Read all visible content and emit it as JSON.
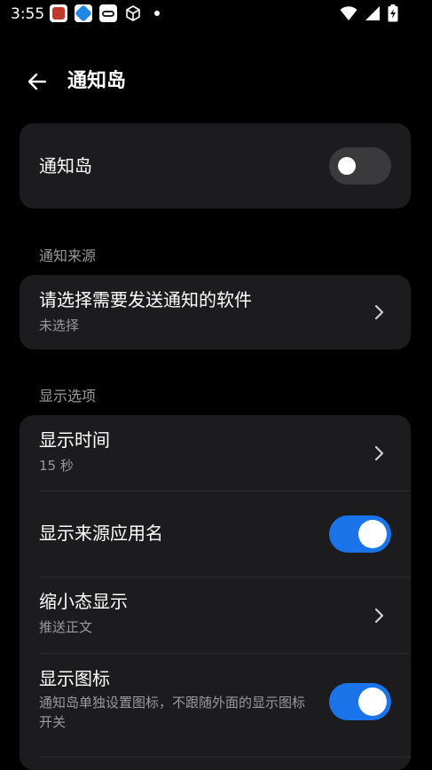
{
  "status_bar": {
    "time": "3:55",
    "icons_left": [
      "app-red-icon",
      "app-blue-icon",
      "link-icon",
      "cube-icon",
      "dot-icon"
    ],
    "icons_right": [
      "wifi-icon",
      "signal-icon",
      "battery-charging-icon"
    ]
  },
  "app_bar": {
    "title": "通知岛"
  },
  "main_toggle": {
    "label": "通知岛",
    "enabled": false
  },
  "sections": {
    "source_header": "通知来源",
    "display_header": "显示选项"
  },
  "source": {
    "title": "请选择需要发送通知的软件",
    "subtitle": "未选择"
  },
  "display_options": {
    "show_time": {
      "title": "显示时间",
      "subtitle": "15 秒"
    },
    "show_app_name": {
      "title": "显示来源应用名",
      "enabled": true
    },
    "mini_display": {
      "title": "缩小态显示",
      "subtitle": "推送正文"
    },
    "show_icon": {
      "title": "显示图标",
      "subtitle": "通知岛单独设置图标，不跟随外面的显示图标开关",
      "enabled": true
    }
  },
  "colors": {
    "background": "#000000",
    "card": "#1c1c1e",
    "accent": "#1a73e8",
    "switch_off": "#3a3a3c",
    "secondary_text": "#9a9a9a"
  }
}
